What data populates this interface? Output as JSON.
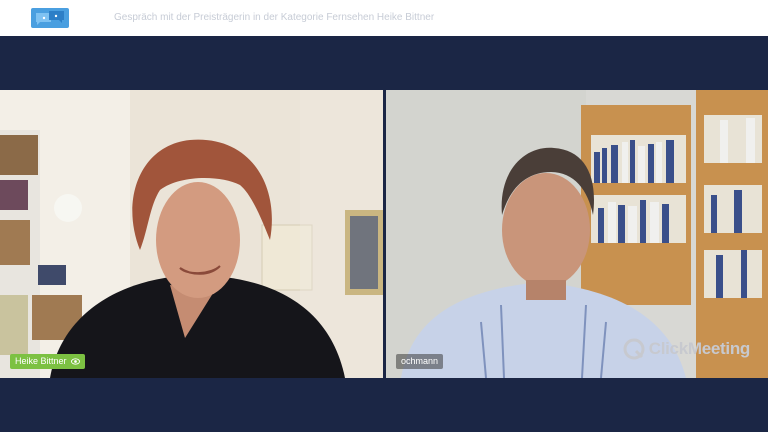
{
  "header": {
    "title": "Gespräch mit der Preisträgerin in der Kategorie Fernsehen Heike Bittner",
    "logo_icon": "chat-bubbles-logo-icon"
  },
  "participants": [
    {
      "name": "Heike Bittner",
      "tag_color": "#7cc142",
      "icon": "eye-icon"
    },
    {
      "name": "ochmann",
      "tag_color": "#595959"
    }
  ],
  "brand": {
    "watermark": "ClickMeeting",
    "accent": "#4a9fe0",
    "background": "#1b2645"
  }
}
